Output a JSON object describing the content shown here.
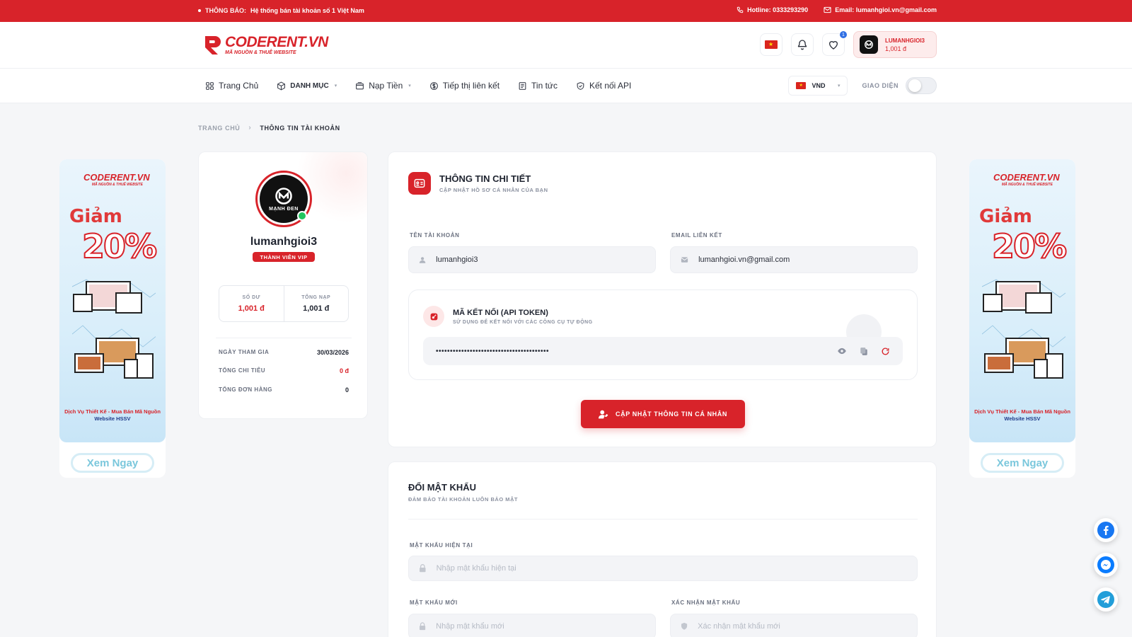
{
  "topbar": {
    "notice_label": "THÔNG BÁO:",
    "notice_text": "Hệ thống bán tài khoản số 1 Việt Nam",
    "hotline": "Hotline: 0333293290",
    "email": "Email: lumanhgioi.vn@gmail.com"
  },
  "header": {
    "logo_main": "CODERENT.VN",
    "logo_sub": "MÃ NGUỒN & THUÊ WEBSITE",
    "notification_count": "1",
    "user_name": "LUMANHGIOI3",
    "user_balance": "1,001 đ"
  },
  "nav": {
    "items": [
      {
        "label": "Trang Chủ"
      },
      {
        "label": "DANH MỤC"
      },
      {
        "label": "Nạp Tiền"
      },
      {
        "label": "Tiếp thị liên kết"
      },
      {
        "label": "Tin tức"
      },
      {
        "label": "Kết nối API"
      }
    ],
    "currency": "VND",
    "theme_label": "GIAO DIỆN"
  },
  "breadcrumb": {
    "home": "TRANG CHỦ",
    "current": "THÔNG TIN TÀI KHOẢN"
  },
  "banner": {
    "logo": "CODERENT.VN",
    "logo_sub": "MÃ NGUỒN & THUÊ WEBSITE",
    "giam": "Giảm",
    "percent": "20%",
    "caption_red": "Dịch Vụ Thiết Kế - Mua Bán Mã Nguồn",
    "caption_blue": "Website  HSSV",
    "button": "Xem Ngay"
  },
  "profile": {
    "avatar_brand": "MẠNH ĐEN",
    "username": "lumanhgioi3",
    "vip": "THÀNH VIÊN VIP",
    "balance_label": "SỐ DƯ",
    "balance_value": "1,001 đ",
    "total_topup_label": "TỔNG NẠP",
    "total_topup_value": "1,001 đ",
    "join_label": "NGÀY THAM GIA",
    "join_value": "30/03/2026",
    "spent_label": "TỔNG CHI TIÊU",
    "spent_value": "0 đ",
    "orders_label": "TỔNG ĐƠN HÀNG",
    "orders_value": "0"
  },
  "details": {
    "title": "THÔNG TIN CHI TIẾT",
    "subtitle": "CẬP NHẬT HỒ SƠ CÁ NHÂN CỦA BẠN",
    "username_label": "TÊN TÀI KHOẢN",
    "username_value": "lumanhgioi3",
    "email_label": "EMAIL LIÊN KẾT",
    "email_value": "lumanhgioi.vn@gmail.com",
    "api_title": "MÃ KẾT NỐI (API TOKEN)",
    "api_subtitle": "SỬ DỤNG ĐỂ KẾT NỐI VỚI CÁC CÔNG CỤ TỰ ĐỘNG",
    "api_token_masked": "••••••••••••••••••••••••••••••••••••••••",
    "update_button": "CẬP NHẬT THÔNG TIN CÁ NHÂN"
  },
  "password": {
    "title": "ĐỔI MẬT KHẨU",
    "subtitle": "ĐẢM BẢO TÀI KHOẢN LUÔN BẢO MẬT",
    "current_label": "MẬT KHẨU HIỆN TẠI",
    "current_placeholder": "Nhập mật khẩu hiện tại",
    "new_label": "MẬT KHẨU MỚI",
    "new_placeholder": "Nhập mật khẩu mới",
    "confirm_label": "XÁC NHẬN MẬT KHẨU",
    "confirm_placeholder": "Xác nhận mật khẩu mới"
  },
  "colors": {
    "brand_red": "#d8232a",
    "facebook_blue": "#1877f2",
    "messenger_blue": "#0a7cff",
    "telegram_blue": "#229ed9"
  },
  "social_icons": [
    "facebook-icon",
    "messenger-icon",
    "telegram-icon"
  ]
}
